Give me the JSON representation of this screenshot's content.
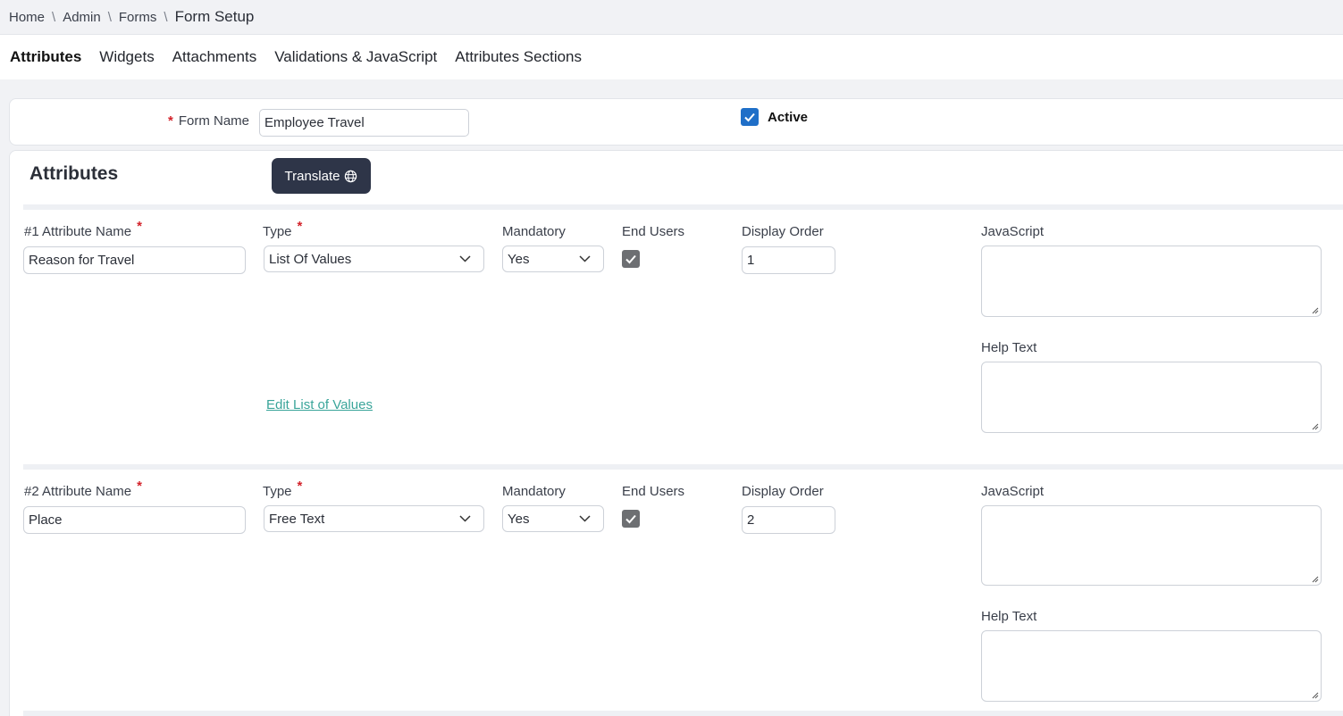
{
  "breadcrumb": {
    "items": [
      "Home",
      "Admin",
      "Forms"
    ],
    "current": "Form Setup"
  },
  "tabs": [
    {
      "label": "Attributes",
      "active": true
    },
    {
      "label": "Widgets"
    },
    {
      "label": "Attachments"
    },
    {
      "label": "Validations & JavaScript"
    },
    {
      "label": "Attributes Sections"
    }
  ],
  "form": {
    "name_label": "Form Name",
    "required_marker": "*",
    "name_value": "Employee Travel",
    "active_label": "Active",
    "active_checked": true
  },
  "attributes": {
    "title": "Attributes",
    "translate_label": "Translate",
    "rows": [
      {
        "name_label": "#1 Attribute Name",
        "name_value": "Reason for Travel",
        "type_label": "Type",
        "type_value": "List Of Values",
        "mandatory_label": "Mandatory",
        "mandatory_value": "Yes",
        "end_users_label": "End Users",
        "display_order_label": "Display Order",
        "display_order_value": "1",
        "javascript_label": "JavaScript",
        "help_text_label": "Help Text",
        "edit_lov_label": "Edit List of Values"
      },
      {
        "name_label": "#2 Attribute Name",
        "name_value": "Place",
        "type_label": "Type",
        "type_value": "Free Text",
        "mandatory_label": "Mandatory",
        "mandatory_value": "Yes",
        "end_users_label": "End Users",
        "display_order_label": "Display Order",
        "display_order_value": "2",
        "javascript_label": "JavaScript",
        "help_text_label": "Help Text"
      }
    ]
  },
  "colors": {
    "accent_dark": "#2e3548",
    "checkbox_blue": "#1f6fc8",
    "required_red": "#d3222a",
    "link_teal": "#3aa59a"
  }
}
